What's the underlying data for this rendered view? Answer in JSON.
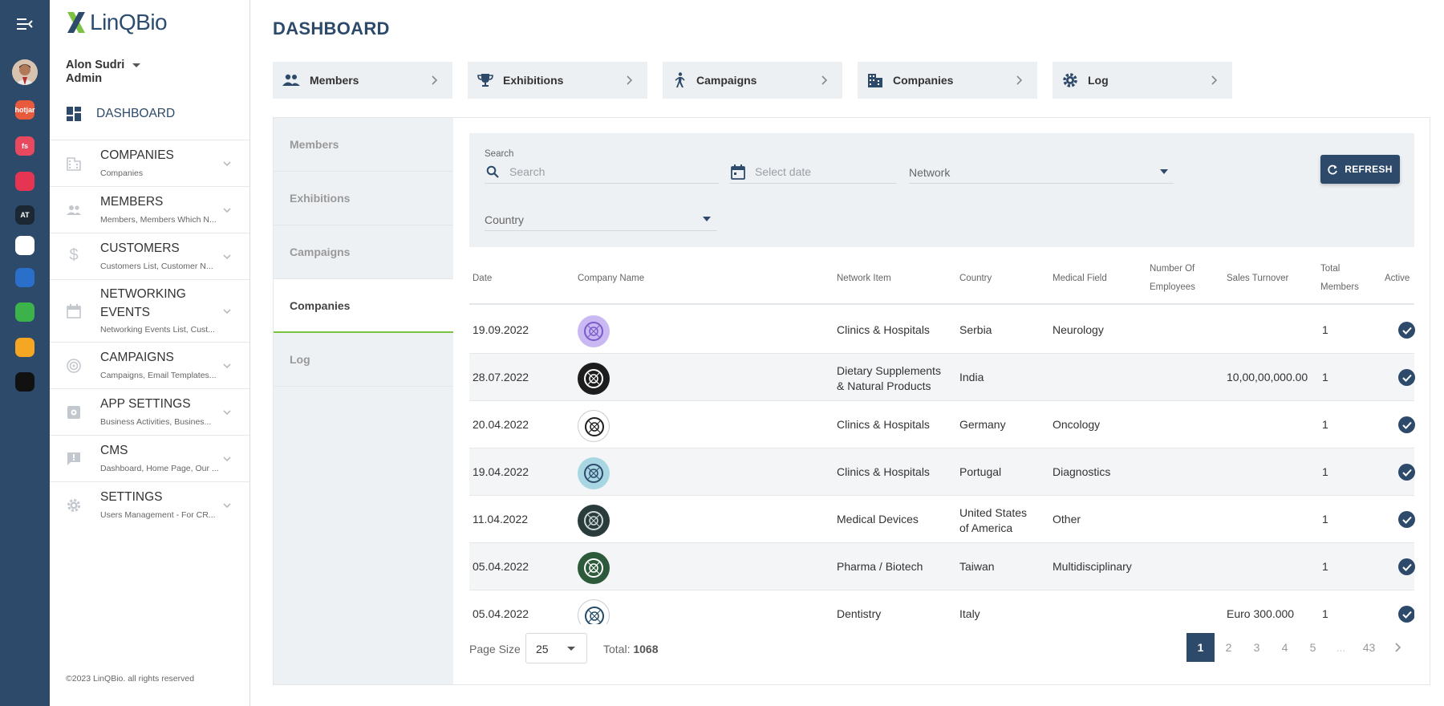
{
  "brand": {
    "logo_text": "LinQBio"
  },
  "user": {
    "name": "Alon Sudri",
    "role": "Admin"
  },
  "rail": {
    "items": [
      {
        "name": "hotjar-app-icon",
        "label": "hotjar",
        "color": "#e85a3c"
      },
      {
        "name": "fs-app-icon",
        "label": "fs",
        "color": "#e8495f"
      },
      {
        "name": "twilio-app-icon",
        "label": "",
        "color": "#e63552"
      },
      {
        "name": "at-app-icon",
        "label": "AT",
        "color": "#1b2733"
      },
      {
        "name": "mail-app-icon",
        "label": "",
        "color": "#ffffff"
      },
      {
        "name": "blue-app-icon",
        "label": "",
        "color": "#2a6fc9"
      },
      {
        "name": "share-app-icon",
        "label": "",
        "color": "#3bb34a"
      },
      {
        "name": "analytics-app-icon",
        "label": "",
        "color": "#f5a623"
      },
      {
        "name": "chat-app-icon",
        "label": "",
        "color": "#111111"
      }
    ]
  },
  "sidebar": {
    "dashboard_label": "DASHBOARD",
    "items": [
      {
        "title": "COMPANIES",
        "sub": "Companies",
        "icon": "building-icon"
      },
      {
        "title": "MEMBERS",
        "sub": "Members, Members Which N...",
        "icon": "people-icon"
      },
      {
        "title": "CUSTOMERS",
        "sub": "Customers List, Customer N...",
        "icon": "dollar-icon"
      },
      {
        "title": "NETWORKING EVENTS",
        "title1": "NETWORKING",
        "title2": "EVENTS",
        "sub": "Networking Events List, Cust...",
        "icon": "calendar-icon"
      },
      {
        "title": "CAMPAIGNS",
        "sub": "Campaigns, Email Templates...",
        "icon": "target-icon"
      },
      {
        "title": "APP SETTINGS",
        "sub": "Business Activities, Busines...",
        "icon": "app-settings-icon"
      },
      {
        "title": "CMS",
        "sub": "Dashboard, Home Page, Our ...",
        "icon": "cms-icon"
      },
      {
        "title": "SETTINGS",
        "sub": "Users Management - For CR...",
        "icon": "gear-icon"
      }
    ],
    "copyright": "©2023 LinQBio. all rights reserved"
  },
  "page_title": "DASHBOARD",
  "quick_buttons": [
    {
      "label": "Members",
      "icon": "people-icon"
    },
    {
      "label": "Exhibitions",
      "icon": "trophy-icon"
    },
    {
      "label": "Campaigns",
      "icon": "person-walking-icon"
    },
    {
      "label": "Companies",
      "icon": "building-icon"
    },
    {
      "label": "Log",
      "icon": "gear-icon"
    }
  ],
  "tabs": [
    "Members",
    "Exhibitions",
    "Campaigns",
    "Companies",
    "Log"
  ],
  "active_tab": "Companies",
  "filters": {
    "search_label": "Search",
    "search_placeholder": "Search",
    "date_placeholder": "Select date",
    "network_label": "Network",
    "country_label": "Country",
    "refresh_label": "REFRESH"
  },
  "table": {
    "headers": {
      "date": "Date",
      "company": "Company Name",
      "network": "Network Item",
      "country": "Country",
      "field": "Medical Field",
      "employees1": "Number Of",
      "employees2": "Employees",
      "turnover": "Sales Turnover",
      "members1": "Total",
      "members2": "Members",
      "active": "Active"
    },
    "rows": [
      {
        "date": "19.09.2022",
        "network1": "Clinics & Hospitals",
        "network2": "",
        "country1": "Serbia",
        "country2": "",
        "field": "Neurology",
        "turnover": "",
        "members": "1",
        "logo_color": "#c9b8f2",
        "logo_fg": "#7a5cc9"
      },
      {
        "date": "28.07.2022",
        "network1": "Dietary Supplements",
        "network2": "& Natural Products",
        "country1": "India",
        "country2": "",
        "field": "",
        "turnover": "10,00,00,000.00",
        "members": "1",
        "logo_color": "#1d1d1d",
        "logo_fg": "#ffffff"
      },
      {
        "date": "20.04.2022",
        "network1": "Clinics & Hospitals",
        "network2": "",
        "country1": "Germany",
        "country2": "",
        "field": "Oncology",
        "turnover": "",
        "members": "1",
        "logo_color": "#ffffff",
        "logo_fg": "#1d1d1d"
      },
      {
        "date": "19.04.2022",
        "network1": "Clinics & Hospitals",
        "network2": "",
        "country1": "Portugal",
        "country2": "",
        "field": "Diagnostics",
        "turnover": "",
        "members": "1",
        "logo_color": "#a8d6e3",
        "logo_fg": "#2e4a6b"
      },
      {
        "date": "11.04.2022",
        "network1": "Medical Devices",
        "network2": "",
        "country1": "United States",
        "country2": "of America",
        "field": "Other",
        "turnover": "",
        "members": "1",
        "logo_color": "#2a3b3b",
        "logo_fg": "#cfd8d8"
      },
      {
        "date": "05.04.2022",
        "network1": "Pharma / Biotech",
        "network2": "",
        "country1": "Taiwan",
        "country2": "",
        "field": "Multidisciplinary",
        "turnover": "",
        "members": "1",
        "logo_color": "#2c5a3a",
        "logo_fg": "#ffffff"
      },
      {
        "date": "05.04.2022",
        "network1": "Dentistry",
        "network2": "",
        "country1": "Italy",
        "country2": "",
        "field": "",
        "turnover": "Euro 300.000",
        "members": "1",
        "logo_color": "#ffffff",
        "logo_fg": "#234a66"
      }
    ]
  },
  "pagination": {
    "page_size_label": "Page Size",
    "page_size": "25",
    "total_label": "Total:",
    "total_value": "1068",
    "pages": [
      "1",
      "2",
      "3",
      "4",
      "5",
      "...",
      "43"
    ],
    "current": "1"
  },
  "colors": {
    "primary": "#2e4a6b",
    "accent_green": "#7cc242",
    "panel_bg": "#eef1f4"
  }
}
